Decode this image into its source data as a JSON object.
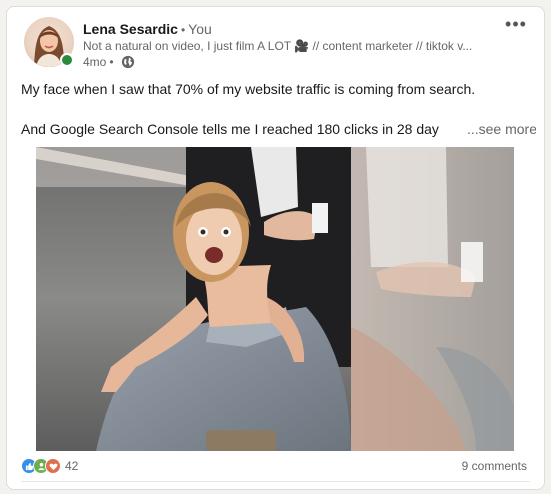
{
  "post": {
    "author": {
      "name": "Lena Sesardic",
      "separator": "•",
      "degree": "You",
      "headline": "Not a natural on video, I just film A LOT 🎥 // content marketer // tiktok v...",
      "time_ago": "4mo",
      "visibility_icon": "globe-icon",
      "online_status_color": "#2b8a3e"
    },
    "menu_label": "•••",
    "text_lines": [
      "My face when I saw that 70% of my website traffic is coming from search.",
      "And Google Search Console tells me I reached 180 clicks in 28 day"
    ],
    "see_more_label": "...see more",
    "image_icon": "post-photo",
    "social": {
      "reaction_icons": [
        "like-icon",
        "support-icon",
        "love-icon"
      ],
      "reaction_count": "42",
      "comments_label": "9 comments"
    }
  },
  "colors": {
    "like": "#378fe9",
    "support": "#6dae4f",
    "love": "#df704d",
    "muted_text": "#666666"
  }
}
